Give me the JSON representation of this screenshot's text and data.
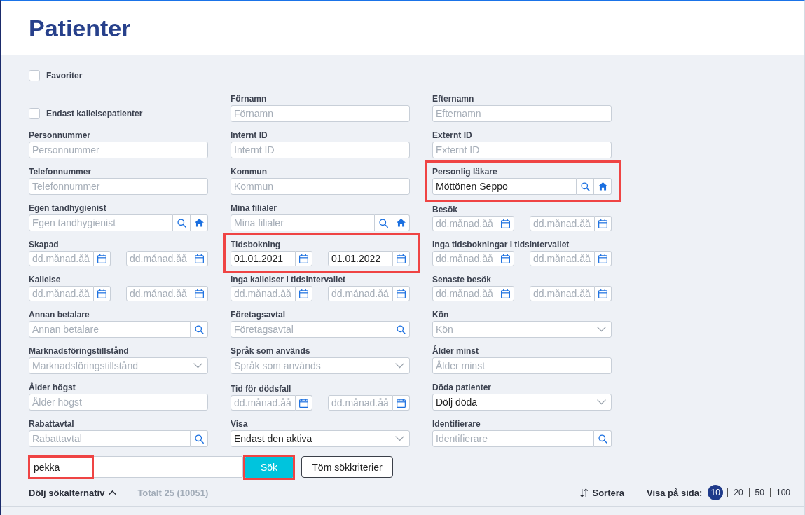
{
  "header": {
    "title": "Patienter"
  },
  "filter_rows": [
    [
      {
        "kind": "checkbox",
        "label": "Favoriter",
        "checked": false,
        "highlighted": false
      }
    ],
    [
      {
        "kind": "checkbox",
        "label": "Endast kallelsepatienter",
        "checked": false,
        "highlighted": false
      },
      {
        "kind": "text",
        "label": "Förnamn",
        "placeholder": "Förnamn",
        "highlighted": false
      },
      {
        "kind": "text",
        "label": "Efternamn",
        "placeholder": "Efternamn",
        "highlighted": false
      }
    ],
    [
      {
        "kind": "text",
        "label": "Personnummer",
        "placeholder": "Personnummer",
        "highlighted": false
      },
      {
        "kind": "text",
        "label": "Internt ID",
        "placeholder": "Internt ID",
        "highlighted": false
      },
      {
        "kind": "text",
        "label": "Externt ID",
        "placeholder": "Externt ID",
        "highlighted": false
      }
    ],
    [
      {
        "kind": "text",
        "label": "Telefonnummer",
        "placeholder": "Telefonnummer",
        "highlighted": false
      },
      {
        "kind": "text",
        "label": "Kommun",
        "placeholder": "Kommun",
        "highlighted": false
      },
      {
        "kind": "lookup",
        "label": "Personlig läkare",
        "value": "Möttönen Seppo",
        "highlighted": true
      }
    ],
    [
      {
        "kind": "lookup",
        "label": "Egen tandhygienist",
        "placeholder": "Egen tandhygienist",
        "highlighted": false
      },
      {
        "kind": "lookup",
        "label": "Mina filialer",
        "placeholder": "Mina filialer",
        "highlighted": false
      },
      {
        "kind": "date_range",
        "label": "Besök",
        "from": {
          "placeholder": "dd.månad.åå"
        },
        "to": {
          "placeholder": "dd.månad.åå"
        },
        "highlighted": false
      }
    ],
    [
      {
        "kind": "date_range",
        "label": "Skapad",
        "from": {
          "placeholder": "dd.månad.åå"
        },
        "to": {
          "placeholder": "dd.månad.åå"
        },
        "highlighted": false
      },
      {
        "kind": "date_range",
        "label": "Tidsbokning",
        "from": {
          "value": "01.01.2021"
        },
        "to": {
          "value": "01.01.2022"
        },
        "highlighted": true
      },
      {
        "kind": "date_range",
        "label": "Inga tidsbokningar i tidsintervallet",
        "from": {
          "placeholder": "dd.månad.åå"
        },
        "to": {
          "placeholder": "dd.månad.åå"
        },
        "highlighted": false
      }
    ],
    [
      {
        "kind": "date_range",
        "label": "Kallelse",
        "from": {
          "placeholder": "dd.månad.åå"
        },
        "to": {
          "placeholder": "dd.månad.åå"
        },
        "highlighted": false
      },
      {
        "kind": "date_range",
        "label": "Inga kallelser i tidsintervallet",
        "from": {
          "placeholder": "dd.månad.åå"
        },
        "to": {
          "placeholder": "dd.månad.åå"
        },
        "highlighted": false
      },
      {
        "kind": "date_range",
        "label": "Senaste besök",
        "from": {
          "placeholder": "dd.månad.åå"
        },
        "to": {
          "placeholder": "dd.månad.åå"
        },
        "highlighted": false
      }
    ],
    [
      {
        "kind": "search",
        "label": "Annan betalare",
        "placeholder": "Annan betalare",
        "highlighted": false
      },
      {
        "kind": "search",
        "label": "Företagsavtal",
        "placeholder": "Företagsavtal",
        "highlighted": false
      },
      {
        "kind": "select",
        "label": "Kön",
        "placeholder": "Kön",
        "highlighted": false
      }
    ],
    [
      {
        "kind": "select",
        "label": "Marknadsföringstillstånd",
        "placeholder": "Marknadsföringstillstånd",
        "highlighted": false
      },
      {
        "kind": "select",
        "label": "Språk som används",
        "placeholder": "Språk som används",
        "highlighted": false
      },
      {
        "kind": "text",
        "label": "Ålder minst",
        "placeholder": "Ålder minst",
        "highlighted": false
      }
    ],
    [
      {
        "kind": "text",
        "label": "Ålder högst",
        "placeholder": "Ålder högst",
        "highlighted": false
      },
      {
        "kind": "date_range",
        "label": "Tid för dödsfall",
        "from": {
          "placeholder": "dd.månad.åå"
        },
        "to": {
          "placeholder": "dd.månad.åå"
        },
        "highlighted": false
      },
      {
        "kind": "select",
        "label": "Döda patienter",
        "value": "Dölj döda",
        "highlighted": false
      }
    ],
    [
      {
        "kind": "search",
        "label": "Rabattavtal",
        "placeholder": "Rabattavtal",
        "highlighted": false
      },
      {
        "kind": "select",
        "label": "Visa",
        "value": "Endast den aktiva",
        "highlighted": false
      },
      {
        "kind": "search",
        "label": "Identifierare",
        "placeholder": "Identifierare",
        "highlighted": false
      }
    ]
  ],
  "search": {
    "value": "pekka",
    "highlighted": true
  },
  "buttons": [
    {
      "kind": "primary",
      "label": "Sök",
      "highlighted": true
    },
    {
      "kind": "secondary",
      "label": "Töm sökkriterier",
      "highlighted": false
    }
  ],
  "footer": {
    "toggle": {
      "label": "Dölj sökalternativ",
      "expanded": true
    },
    "total": "Totalt 25 (10051)",
    "sort": {
      "label": "Sortera"
    },
    "page_size": {
      "label": "Visa på sida:",
      "options": [
        {
          "label": "10",
          "selected": true
        },
        {
          "label": "20",
          "selected": false
        },
        {
          "label": "50",
          "selected": false
        },
        {
          "label": "100",
          "selected": false
        }
      ]
    }
  }
}
